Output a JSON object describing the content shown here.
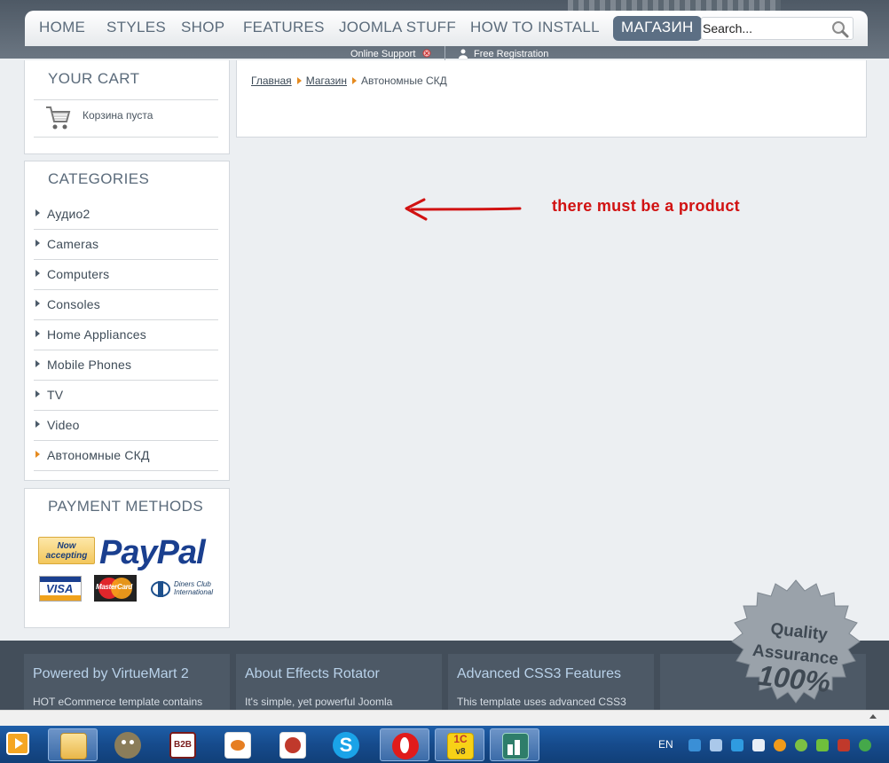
{
  "nav": {
    "items": [
      "HOME",
      "STYLES",
      "SHOP",
      "FEATURES",
      "JOOMLA STUFF",
      "HOW TO INSTALL",
      "МАГАЗИН"
    ],
    "active_index": 6
  },
  "search": {
    "placeholder": "Search..."
  },
  "subnav": {
    "online_support": "Online Support",
    "free_registration": "Free Registration"
  },
  "cart": {
    "title": "YOUR CART",
    "empty_text": "Корзина пуста"
  },
  "categories": {
    "title": "CATEGORIES",
    "items": [
      "Аудио2",
      "Cameras",
      "Computers",
      "Consoles",
      "Home Appliances",
      "Mobile Phones",
      "TV",
      "Video",
      "Автономные СКД"
    ],
    "active": "Автономные СКД"
  },
  "payment": {
    "title": "PAYMENT METHODS",
    "now_accepting": "Now accepting",
    "paypal": "PayPal",
    "cards": [
      "VISA",
      "MasterCard",
      "Diners Club International"
    ]
  },
  "breadcrumb": {
    "home": "Главная",
    "shop": "Магазин",
    "current": "Автономные СКД"
  },
  "annotation": "there must be a product",
  "footer": {
    "columns": [
      {
        "title": "Powered by VirtueMart 2",
        "text": "HOT eCommerce template contains"
      },
      {
        "title": "About Effects Rotator",
        "text": "It's simple, yet powerful Joomla"
      },
      {
        "title": "Advanced CSS3 Features",
        "text": "This template uses advanced CSS3"
      }
    ]
  },
  "badge": {
    "line1": "Quality",
    "line2": "Assurance",
    "line3": "100%"
  },
  "taskbar": {
    "lang": "EN",
    "apps": [
      "media-player",
      "file-explorer",
      "gimp",
      "b2b-app",
      "app-orange",
      "app-seal",
      "skype",
      "opera",
      "1c-v8",
      "app-green"
    ],
    "labels": {
      "b2b": "B2B",
      "onec": "1С",
      "onec_v": "v8"
    }
  },
  "colors": {
    "accent": "#5c6f84",
    "annotation": "#d11212",
    "paypal": "#1a3f8f",
    "footer": "#434e5a"
  }
}
